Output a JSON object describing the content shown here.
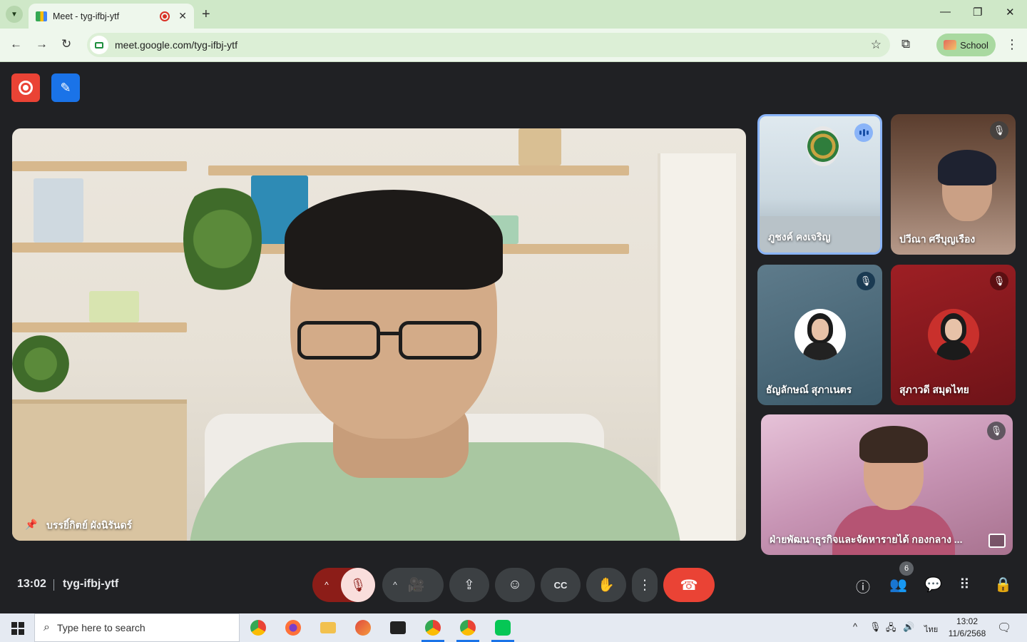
{
  "browser": {
    "tab": {
      "title": "Meet - tyg-ifbj-ytf",
      "close": "✕"
    },
    "new_tab": "+",
    "window_controls": {
      "minimize": "—",
      "maximize": "❐",
      "close": "✕"
    },
    "nav": {
      "back": "←",
      "forward": "→",
      "reload": "↻"
    },
    "url": "meet.google.com/tyg-ifbj-ytf",
    "star": "☆",
    "extensions": "⧉",
    "profile_label": "School",
    "menu": "⋮",
    "accent": "#cfe8c8"
  },
  "meet": {
    "main_speaker": {
      "name": "บรรยิ์กิตย์ ผังนิรันดร์"
    },
    "participants": [
      {
        "name": "ภูชงค์ คงเจริญ",
        "status": "speaking"
      },
      {
        "name": "ปวีณา ศรีบุญเรือง",
        "status": "muted"
      },
      {
        "name": "ธัญลักษณ์ สุภาเนตร",
        "status": "muted"
      },
      {
        "name": "สุภาวดี สมุดไทย",
        "status": "muted"
      },
      {
        "name": "ฝ่ายพัฒนาธุรกิจและจัดหารายได้ กองกลาง ...",
        "status": "muted"
      }
    ],
    "icons": {
      "muted": "🎙",
      "pin": "📌"
    },
    "bottom_bar": {
      "time": "13:02",
      "meeting_code": "tyg-ifbj-ytf",
      "mic_arrow": "^",
      "mic_icon": "🎙",
      "cam_arrow": "^",
      "cam_icon": "🎥",
      "present_icon": "⇪",
      "emoji_icon": "☺",
      "captions_icon": "CC",
      "hand_icon": "✋",
      "more_icon": "⋮",
      "end_icon": "☎",
      "info_icon": "ⓘ",
      "people_icon": "👥",
      "people_count": "6",
      "chat_icon": "💬",
      "activities_icon": "⠿",
      "host_icon": "🔒"
    },
    "end_call_color": "#ea4335",
    "record_color": "#ea4335"
  },
  "taskbar": {
    "search_placeholder": "Type here to search",
    "tray_language": "ไทย",
    "clock_time": "13:02",
    "clock_date": "11/6/2568",
    "tray_chevron": "^",
    "tray_mic": "🎙",
    "tray_network": "🖧",
    "tray_volume": "🔊",
    "notifications": "🗨"
  }
}
